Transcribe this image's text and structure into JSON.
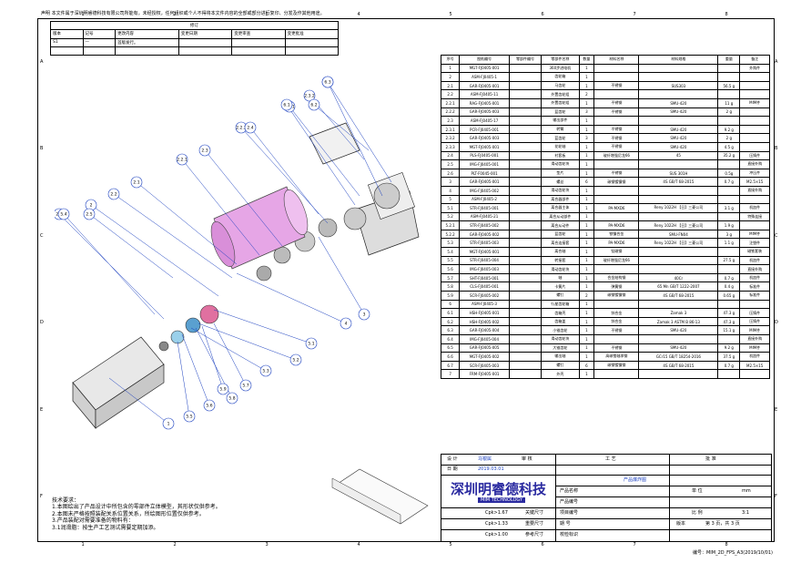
{
  "top_notice": "声明 本文件属于深圳明睿德科技有限公司所能有，未经授权，任何组织或个人不得将本文件内容的全部或部分进行复印、分发及作其他用途。",
  "columns": [
    "1",
    "2",
    "3",
    "4",
    "5",
    "6",
    "7",
    "8"
  ],
  "rows": [
    "A",
    "B",
    "C",
    "D",
    "E",
    "F"
  ],
  "revision": {
    "title": "修订",
    "headers": [
      "版本",
      "记号",
      "更改内容",
      "变更日期",
      "变更审查",
      "变更批准"
    ],
    "rows": [
      [
        "S1",
        "—",
        "首版发行。",
        "",
        "",
        ""
      ]
    ]
  },
  "bom": {
    "headers": [
      "序号",
      "图纸编号",
      "零部件编号",
      "零部件名称",
      "数量",
      "材料名称",
      "材料规格",
      "重量",
      "备注"
    ],
    "rows": [
      [
        "1",
        "MGT-FJ0405-001",
        "",
        "360步进电机",
        "1",
        "",
        "",
        "",
        "外购件"
      ],
      [
        "2",
        "ASM-FJ0405-1",
        "",
        "齿轮箱",
        "1",
        "",
        "",
        "",
        ""
      ],
      [
        "2.1",
        "GAR-FJ0405-001",
        "",
        "马齿轮",
        "1",
        "不锈钢",
        "SUS303",
        "56.5 g",
        ""
      ],
      [
        "2.2",
        "ASM-FJ0405-11",
        "",
        "外置齿轮组",
        "2",
        "",
        "",
        "",
        ""
      ],
      [
        "2.2.1",
        "RAG-FJ0405-001",
        "",
        "外置齿轮组",
        "1",
        "不锈钢",
        "SMU-420",
        "11 g",
        "MIM件"
      ],
      [
        "2.2.2",
        "GAR-FJ0405-003",
        "",
        "蓝齿轮",
        "3",
        "不锈钢",
        "SMU-420",
        "2 g",
        ""
      ],
      [
        "2.3",
        "ASM-FJ0405-17",
        "",
        "输出部件",
        "1",
        "",
        "",
        "",
        ""
      ],
      [
        "2.3.1",
        "PCR-FJ0405-001",
        "",
        "转臂",
        "1",
        "不锈钢",
        "SMU-420",
        "9.2 g",
        ""
      ],
      [
        "2.3.2",
        "GAR-FJ0405-003",
        "",
        "蓝齿轮",
        "3",
        "不锈钢",
        "SMU-420",
        "2 g",
        ""
      ],
      [
        "2.3.3",
        "MGT-FJ0405-001",
        "",
        "花轮轴",
        "1",
        "不锈钢",
        "SMU-420",
        "4.5 g",
        ""
      ],
      [
        "2.4",
        "PLS-FJ0405-001",
        "",
        "衬套板",
        "1",
        "玻纤增强尼龙66",
        "45",
        "35.2 g",
        "压铸件"
      ],
      [
        "2.5",
        "IMG-FJ0405-001",
        "",
        "滑动齿轮块",
        "1",
        "",
        "",
        "",
        "直接外购"
      ],
      [
        "2.6",
        "PLT-F0045-001",
        "",
        "垫片",
        "1",
        "不锈钢",
        "SUS 301H",
        "0.5g",
        "冲压件"
      ],
      [
        "3",
        "GAR-FJ0405-001",
        "",
        "螺丝",
        "6",
        "碳钢镀镍钢",
        "4S GB/T 68-2015",
        "0.7 g",
        "M2.5×15"
      ],
      [
        "4",
        "IMG-FJ0405-002",
        "",
        "滑动齿轮块",
        "1",
        "",
        "",
        "",
        "直接外购"
      ],
      [
        "5",
        "ASM-FJ0405-2",
        "",
        "离合器部件",
        "1",
        "",
        "",
        "",
        ""
      ],
      [
        "5.1",
        "STR-FJ0405-001",
        "",
        "离合器主体",
        "1",
        "PA-MXD6",
        "Reny 1022H 【日】三菱公司",
        "3.1 g",
        "机加件"
      ],
      [
        "5.2",
        "ASM-FJ0405-21",
        "",
        "离合从动部件",
        "1",
        "",
        "",
        "",
        "特殊连接"
      ],
      [
        "5.2.1",
        "STR-FJ0405-002",
        "",
        "离合从动件",
        "1",
        "PA-MXD6",
        "Reny 1022H 【日】三菱公司",
        "1.9 g",
        ""
      ],
      [
        "5.2.2",
        "GAR-FJ0405-002",
        "",
        "蓝齿轮",
        "1",
        "铁镍合金",
        "SMU-FN04",
        "3 g",
        "MIM件"
      ],
      [
        "5.3",
        "STR-FJ0405-003",
        "",
        "离合连接套",
        "1",
        "PA-MXD6",
        "Reny 1022H 【日】三菱公司",
        "1.1 g",
        "注塑件"
      ],
      [
        "5.4",
        "MGT-FJ0405-001",
        "",
        "离合轴",
        "1",
        "钛磁钢",
        "",
        "",
        "磁铁套装"
      ],
      [
        "5.5",
        "STR-FJ0405-004",
        "",
        "转接套",
        "1",
        "玻纤增强尼龙66",
        "",
        "27.5 g",
        "机加件"
      ],
      [
        "5.6",
        "IMG-FJ0405-003",
        "",
        "滑动齿轮块",
        "1",
        "",
        "",
        "",
        "直接外购"
      ],
      [
        "5.7",
        "SHT-FJ0405-001",
        "",
        "轴",
        "1",
        "合金结构钢",
        "40Cr",
        "0.7 g",
        "机加件"
      ],
      [
        "5.8",
        "CLS-FJ0405-001",
        "",
        "卡簧片",
        "1",
        "弹簧钢",
        "65 Mn GB/T 1222-2007",
        "0.4 g",
        "标准件"
      ],
      [
        "5.9",
        "SCR-FJ0405-002",
        "",
        "螺钉",
        "2",
        "碳钢镀镍钢",
        "4S GB/T 68-2015",
        "0.65 g",
        "标准件"
      ],
      [
        "6",
        "ASM-FJ0405-3",
        "",
        "行星齿轮箱",
        "1",
        "",
        "",
        "",
        ""
      ],
      [
        "6.1",
        "HSH-FJ0405-001",
        "",
        "齿箱壳",
        "1",
        "锌合金",
        "Zamak 3",
        "47.3 g",
        "压铸件"
      ],
      [
        "6.2",
        "HSH-FJ0405-002",
        "",
        "齿箱盖",
        "1",
        "锌合金",
        "Zamak 3 ASTM B 86-13",
        "47.3 g",
        "压铸件"
      ],
      [
        "6.3",
        "GAR-FJ0405-004",
        "",
        "小锥齿轮",
        "1",
        "不锈钢",
        "SMU-420",
        "15.1 g",
        "MIM件"
      ],
      [
        "6.4",
        "IMG-FJ0405-004",
        "",
        "滑动齿轮块",
        "1",
        "",
        "",
        "",
        "直接外购"
      ],
      [
        "6.5",
        "GAR-FJ0405-005",
        "",
        "大锥齿轮",
        "1",
        "不锈钢",
        "SMU-420",
        "9.2 g",
        "MIM件"
      ],
      [
        "6.6",
        "MGT-FJ0405-002",
        "",
        "输出轴",
        "1",
        "高碳铬轴承钢",
        "GCr15 GB/T 18254-2016",
        "37.5 g",
        "机加件"
      ],
      [
        "6.7",
        "SCR-FJ0405-003",
        "",
        "螺钉",
        "6",
        "碳钢镀镍钢",
        "4S GB/T 68-2015",
        "0.7 g",
        "M2.5×15"
      ],
      [
        "7",
        "FRM-FJ0405-001",
        "",
        "外壳",
        "1",
        "",
        "",
        "",
        ""
      ]
    ]
  },
  "title_block": {
    "design_label": "设  计",
    "designer": "马银属",
    "date": "2019.03.01",
    "review": "审  核",
    "craft": "工  艺",
    "approve": "批  准",
    "date_label": "日  期",
    "company": "深圳明睿德科技",
    "company_en": "MIM TECHNOLOGY",
    "product_name_label": "产品名称",
    "product_code_label": "产品编号",
    "project_code_label": "项目编号",
    "period_label": "期    号",
    "check_label": "校检标识",
    "unit_label": "单  位",
    "unit_value": "mm",
    "scale_label": "比  例",
    "scale_value": "3:1",
    "page_value": "第 3 页，共 3 页",
    "product_section": "产品爆炸图",
    "cpk": [
      "Cpk>1.67",
      "Cpk>1.33",
      "Cpk>1.00"
    ],
    "sym": [
      "关键尺寸",
      "重要尺寸",
      "参考尺寸"
    ],
    "edition_label": "版本"
  },
  "notes": {
    "title": "技术要求：",
    "items": [
      "1.本图绘出了产品设计中所包含的零部件立体模型，其形状仅供参考。",
      "2.本图未严格按照装配关系位置关系，所绘图形位置仅供参考。",
      "3.产品装配对需要准备的物料有：",
      "  3.1润滑脂：按生产工艺测试需要定期加添。"
    ]
  },
  "callouts": [
    "1",
    "2",
    "2.1",
    "2.2",
    "2.2.1",
    "2.2.2",
    "2.3",
    "2.3.1",
    "2.3.2",
    "2.3.3",
    "2.4",
    "2.5",
    "2.6",
    "3",
    "4",
    "5.1",
    "5.2",
    "5.3",
    "5.4",
    "5.5",
    "5.6",
    "5.7",
    "5.8",
    "5.9",
    "6.1",
    "6.2",
    "6.3"
  ],
  "footer": "编号：MIM_2D_FPS_A3(2019/10/01)"
}
